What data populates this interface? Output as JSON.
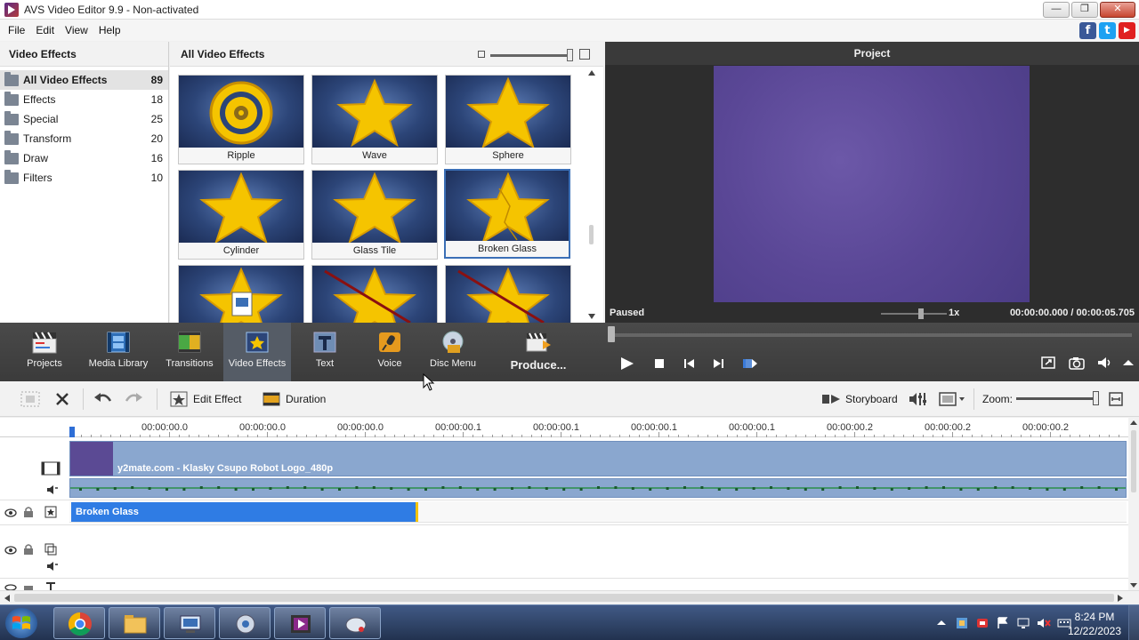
{
  "window": {
    "title": "AVS Video Editor 9.9 - Non-activated",
    "buttons": {
      "minimize": "—",
      "maximize": "❐",
      "close": "✕"
    }
  },
  "menu": [
    "File",
    "Edit",
    "View",
    "Help"
  ],
  "social": {
    "facebook": "f",
    "twitter": "t",
    "youtube": "▶"
  },
  "categories_panel": {
    "title": "Video Effects",
    "items": [
      {
        "label": "All Video Effects",
        "count": "89",
        "active": true
      },
      {
        "label": "Effects",
        "count": "18"
      },
      {
        "label": "Special",
        "count": "25"
      },
      {
        "label": "Transform",
        "count": "20"
      },
      {
        "label": "Draw",
        "count": "16"
      },
      {
        "label": "Filters",
        "count": "10"
      }
    ]
  },
  "effects_panel": {
    "title": "All Video Effects",
    "tiles": [
      {
        "label": "Ripple",
        "variant": "ripple"
      },
      {
        "label": "Wave",
        "variant": "wave"
      },
      {
        "label": "Sphere",
        "variant": "star"
      },
      {
        "label": "Cylinder",
        "variant": "star"
      },
      {
        "label": "Glass Tile",
        "variant": "star"
      },
      {
        "label": "Broken Glass",
        "variant": "broken",
        "selected": true
      },
      {
        "label": "",
        "variant": "doc"
      },
      {
        "label": "",
        "variant": "line"
      },
      {
        "label": "",
        "variant": "line"
      }
    ]
  },
  "preview": {
    "title": "Project",
    "status": "Paused",
    "speed": "1x",
    "timecode": "00:00:00.000 / 00:00:05.705",
    "canvas_color": "#5a4796"
  },
  "toolbar": {
    "tools": [
      {
        "name": "projects",
        "label": "Projects"
      },
      {
        "name": "media-library",
        "label": "Media Library"
      },
      {
        "name": "transitions",
        "label": "Transitions"
      },
      {
        "name": "video-effects",
        "label": "Video Effects",
        "active": true
      },
      {
        "name": "text",
        "label": "Text"
      },
      {
        "name": "voice",
        "label": "Voice"
      },
      {
        "name": "disc-menu",
        "label": "Disc Menu"
      },
      {
        "name": "produce",
        "label": "Produce..."
      }
    ]
  },
  "timeline_toolbar": {
    "edit_effect": "Edit Effect",
    "duration": "Duration",
    "storyboard": "Storyboard",
    "zoom_label": "Zoom:"
  },
  "timeline": {
    "ruler_labels": [
      "00:00:00.0",
      "00:00:00.0",
      "00:00:00.0",
      "00:00:00.1",
      "00:00:00.1",
      "00:00:00.1",
      "00:00:00.1",
      "00:00:00.2",
      "00:00:00.2",
      "00:00:00.2"
    ],
    "video_clip_name": "y2mate.com - Klasky Csupo Robot Logo_480p",
    "effect_clip_name": "Broken Glass"
  },
  "taskbar": {
    "time": "8:24 PM",
    "date": "12/22/2023"
  },
  "colors": {
    "accent_blue": "#2f7ce4",
    "clip_blue": "#8aa7cf",
    "star_yellow": "#f5c400"
  }
}
